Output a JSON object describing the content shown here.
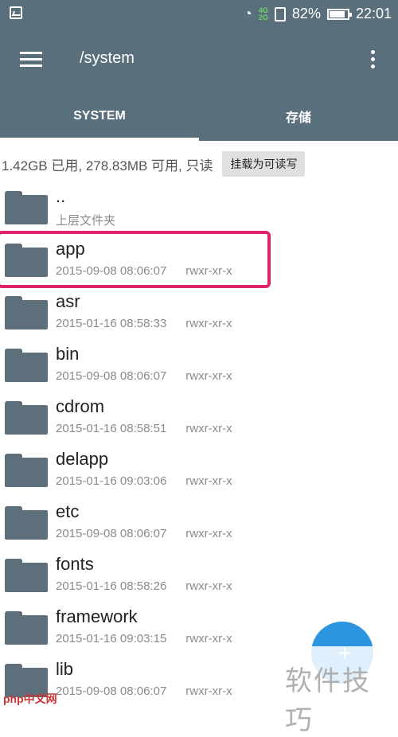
{
  "status_bar": {
    "network_top": "4G",
    "network_bottom": "2G",
    "battery": "82%",
    "time": "22:01"
  },
  "app_bar": {
    "title": "/system"
  },
  "tabs": [
    {
      "label": "SYSTEM",
      "active": true
    },
    {
      "label": "存储",
      "active": false
    }
  ],
  "storage": {
    "info": "1.42GB 已用, 278.83MB 可用, 只读",
    "mount_button": "挂载为可读写"
  },
  "files": [
    {
      "name": "..",
      "detail": "上层文件夹",
      "perm": ""
    },
    {
      "name": "app",
      "detail": "2015-09-08 08:06:07",
      "perm": "rwxr-xr-x"
    },
    {
      "name": "asr",
      "detail": "2015-01-16 08:58:33",
      "perm": "rwxr-xr-x"
    },
    {
      "name": "bin",
      "detail": "2015-09-08 08:06:07",
      "perm": "rwxr-xr-x"
    },
    {
      "name": "cdrom",
      "detail": "2015-01-16 08:58:51",
      "perm": "rwxr-xr-x"
    },
    {
      "name": "delapp",
      "detail": "2015-01-16 09:03:06",
      "perm": "rwxr-xr-x"
    },
    {
      "name": "etc",
      "detail": "2015-09-08 08:06:07",
      "perm": "rwxr-xr-x"
    },
    {
      "name": "fonts",
      "detail": "2015-01-16 08:58:26",
      "perm": "rwxr-xr-x"
    },
    {
      "name": "framework",
      "detail": "2015-01-16 09:03:15",
      "perm": "rwxr-xr-x"
    },
    {
      "name": "lib",
      "detail": "2015-09-08 08:06:07",
      "perm": "rwxr-xr-x"
    }
  ],
  "fab": {
    "icon": "+"
  },
  "watermark": {
    "text": "软件技巧",
    "logo": "php中文网"
  },
  "colors": {
    "primary": "#596f7b",
    "highlight": "#e0226a",
    "fab": "#2b95e0",
    "folder": "#5d6f7a"
  }
}
